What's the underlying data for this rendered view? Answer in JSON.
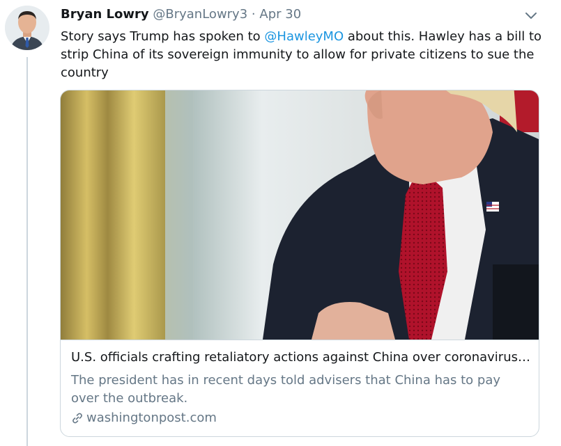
{
  "tweet": {
    "author_name": "Bryan Lowry",
    "handle": "@BryanLowry3",
    "separator": "·",
    "date": "Apr 30",
    "text_before": "Story says Trump has spoken to ",
    "mention": "@HawleyMO",
    "text_after": " about this. Hawley has a bill to strip China of its sovereign immunity to allow for private citizens to sue the country"
  },
  "card": {
    "title": "U.S. officials crafting retaliatory actions against China over coronavirus a...",
    "description": "The president has in recent days told advisers that China has to pay over the outbreak.",
    "domain": "washingtonpost.com"
  },
  "icons": {
    "menu": "chevron-down-icon",
    "link": "link-icon"
  },
  "colors": {
    "link_blue": "#1b95e0",
    "muted_gray": "#657786",
    "border": "#ccd6dd"
  }
}
